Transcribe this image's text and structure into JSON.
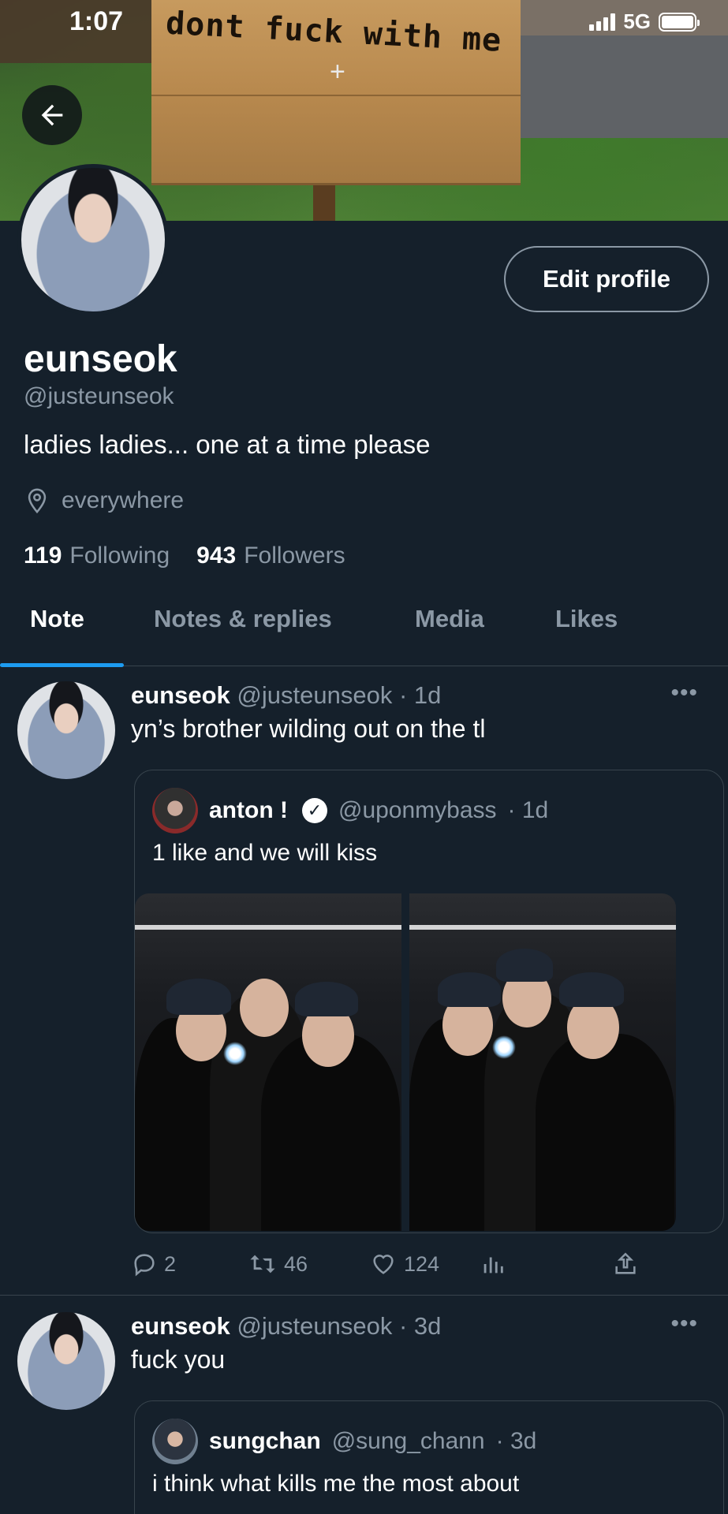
{
  "status_bar": {
    "time": "1:07",
    "network": "5G"
  },
  "banner": {
    "sign_text": "dont fuck with me"
  },
  "profile": {
    "edit_label": "Edit profile",
    "name": "eunseok",
    "handle": "@justeunseok",
    "bio": "ladies ladies... one at a time please",
    "location": "everywhere",
    "following_count": "119",
    "following_label": "Following",
    "followers_count": "943",
    "followers_label": "Followers"
  },
  "tabs": [
    {
      "label": "Note",
      "active": true
    },
    {
      "label": "Notes & replies",
      "active": false
    },
    {
      "label": "Media",
      "active": false
    },
    {
      "label": "Likes",
      "active": false
    }
  ],
  "posts": [
    {
      "author_name": "eunseok",
      "author_handle": "@justeunseok",
      "time": "· 1d",
      "text": "yn’s brother wilding out on the tl",
      "quote": {
        "author_name": "anton !",
        "author_handle": "@uponmybass",
        "time": "· 1d",
        "text": "1 like and we will kiss"
      },
      "replies": "2",
      "reposts": "46",
      "likes": "124"
    },
    {
      "author_name": "eunseok",
      "author_handle": "@justeunseok",
      "time": "· 3d",
      "text": "fuck you",
      "quote": {
        "author_name": "sungchan",
        "author_handle": "@sung_chann",
        "time": "· 3d",
        "text": "i think what kills me the most about"
      }
    }
  ],
  "more_label": "•••"
}
